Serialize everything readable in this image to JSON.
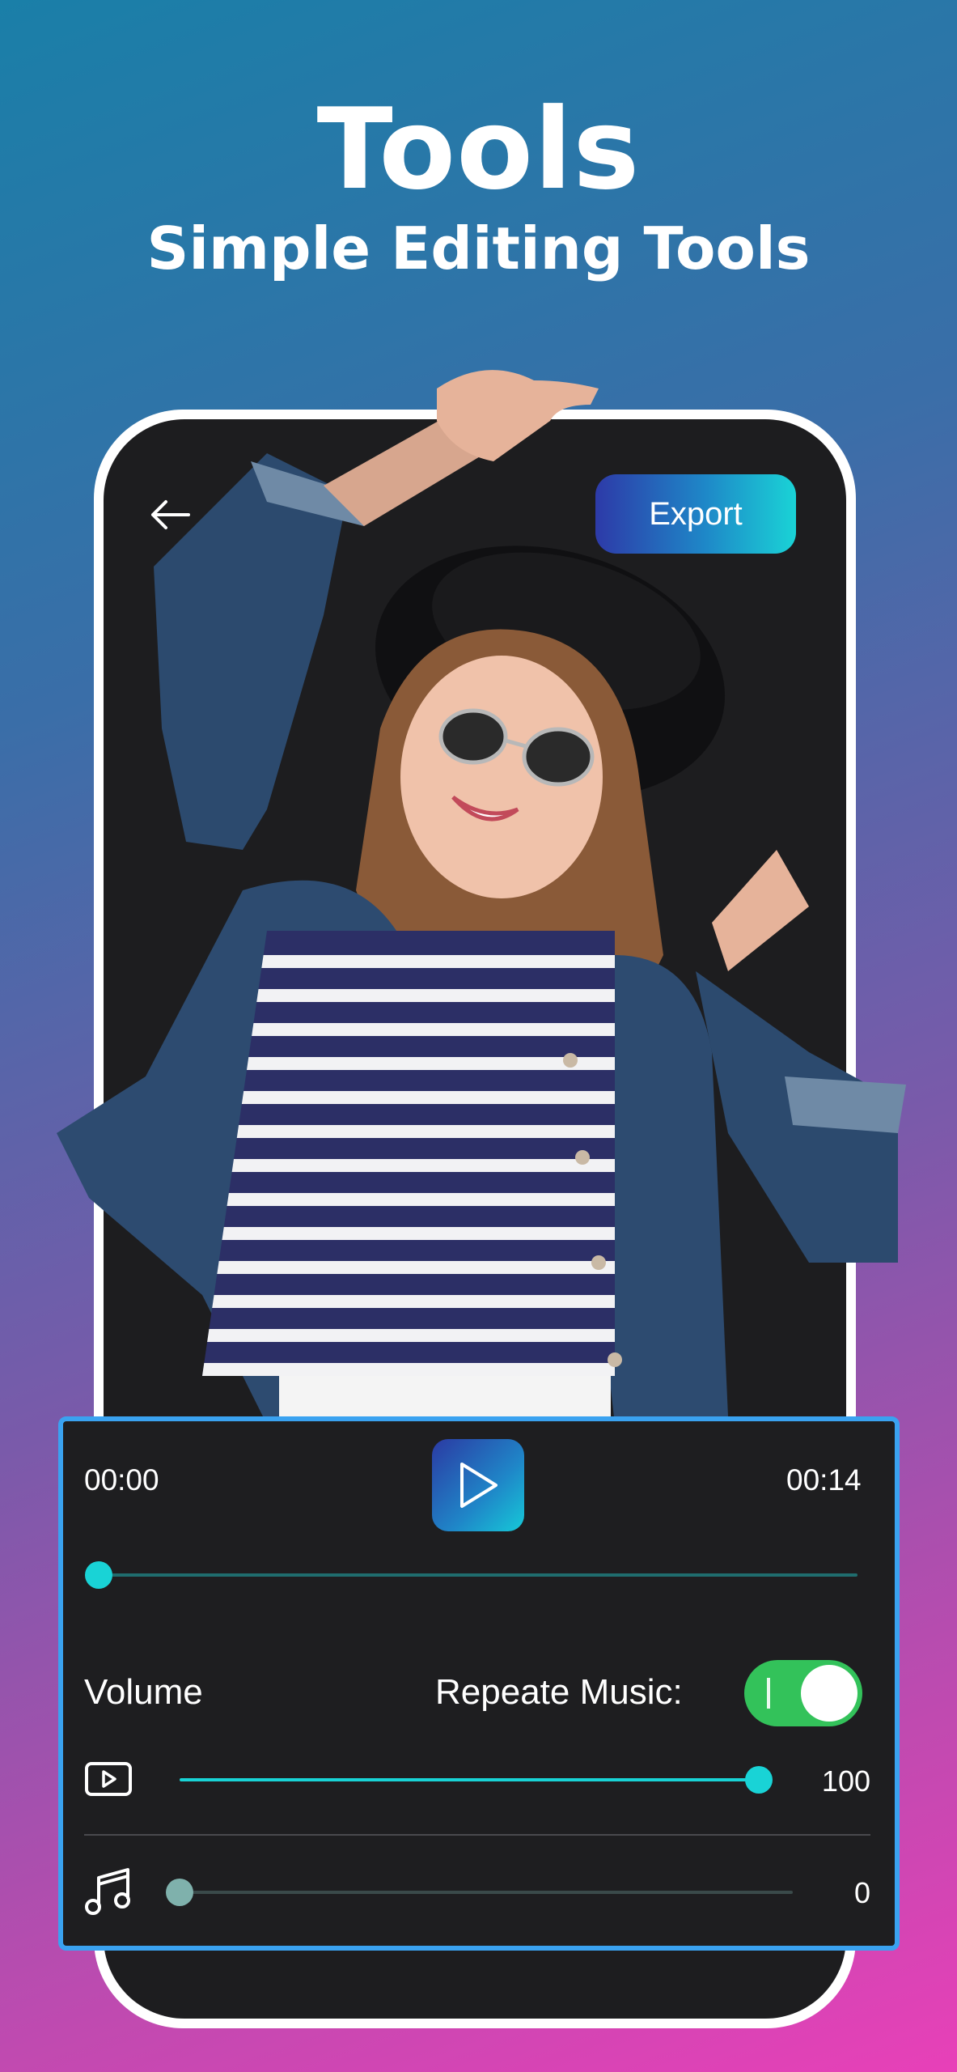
{
  "hero": {
    "title": "Tools",
    "subtitle": "Simple Editing Tools"
  },
  "header": {
    "back_icon": "arrow-left-icon",
    "export_label": "Export"
  },
  "player": {
    "current_time": "00:00",
    "total_time": "00:14",
    "play_icon": "play-icon",
    "progress": 0
  },
  "settings": {
    "volume_label": "Volume",
    "repeat_label": "Repeate Music:",
    "repeat_on": true,
    "video_volume": {
      "icon": "video-icon",
      "value": "100",
      "level": 1.0
    },
    "music_volume": {
      "icon": "music-note-icon",
      "value": "0",
      "level": 0.0
    }
  },
  "colors": {
    "accent_cyan": "#19d3d6",
    "toggle_green": "#33c25a",
    "panel_border": "#3aa2f0"
  }
}
